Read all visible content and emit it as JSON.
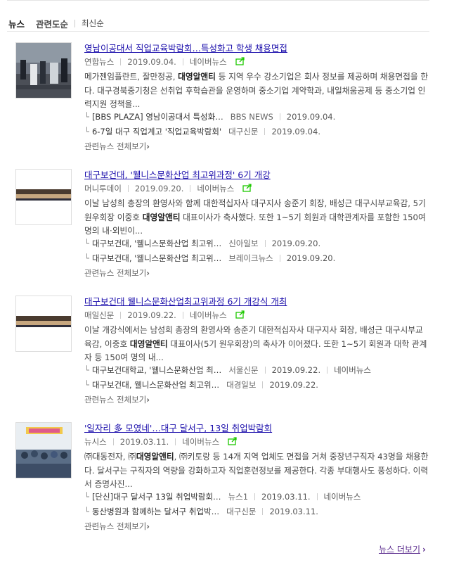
{
  "tabs": [
    {
      "label": "뉴스"
    },
    {
      "label": "관련도순"
    },
    {
      "label": "최신순"
    }
  ],
  "chevron": "›",
  "articles": [
    {
      "title": "영남이공대서 직업교육박람회…특성화고 학생 채용면접",
      "source": "연합뉴스",
      "date": "2019.09.04.",
      "portal": "네이버뉴스",
      "desc_pre": "메가젠임플란트, 잘만정공, ",
      "desc_bold": "대영알앤티",
      "desc_post": " 등 지역 우수 강소기업은 회사 정보를 제공하며 채용면접을 한다. 대구경북중기청은 선취업 후학습관을 운영하며 중소기업 계약학과, 내일채움공제 등 중소기업 인력지원 정책을...",
      "related": [
        {
          "title": "[BBS PLAZA] 영남이공대서 특성화…",
          "source": "BBS NEWS",
          "date": "2019.09.04."
        },
        {
          "title": "6-7일 대구 직업계고 '직업교육박람회'",
          "source": "대구신문",
          "date": "2019.09.04."
        }
      ],
      "more": "관련뉴스 전체보기"
    },
    {
      "title": "대구보건대, '웰니스문화산업 최고위과정' 6기 개강",
      "source": "머니투데이",
      "date": "2019.09.20.",
      "portal": "네이버뉴스",
      "desc_pre": "이날 남성희 총장의 환영사와 함께 대한적십자사 대구지사 송준기 회장, 배성근 대구시부교육감, 5기 원우회장 이중호 ",
      "desc_bold": "대영알앤티",
      "desc_post": " 대표이사가 축사했다. 또한 1~5기 회원과 대학관계자를 포함한 150여 명의 내·외빈이...",
      "related": [
        {
          "title": "대구보건대, '웰니스문화산업 최고위…",
          "source": "신아일보",
          "date": "2019.09.20."
        },
        {
          "title": "대구보건대, '웰니스문화산업 최고위…",
          "source": "브레이크뉴스",
          "date": "2019.09.20."
        }
      ],
      "more": "관련뉴스 전체보기"
    },
    {
      "title": "대구보건대 웰니스문화산업최고위과정 6기 개강식 개최",
      "source": "매일신문",
      "date": "2019.09.22.",
      "portal": "네이버뉴스",
      "desc_pre": "이날 개강식에서는 남성희 총장의 환영사와 송준기 대한적십자사 대구지사 회장, 배성근 대구시부교육감, 이중호 ",
      "desc_bold": "대영알앤티",
      "desc_post": " 대표이사(5기 원우회장)의 축사가 이어졌다. 또한 1~5기 회원과 대학 관계자 등 150여 명의 내...",
      "related": [
        {
          "title": "대구보건대학교, '웰니스문화산업 최…",
          "source": "서울신문",
          "date": "2019.09.22.",
          "portal": "네이버뉴스"
        },
        {
          "title": "대구보건대, 웰니스문화산업 최고위…",
          "source": "대경일보",
          "date": "2019.09.22."
        }
      ],
      "more": "관련뉴스 전체보기"
    },
    {
      "title": "'일자리 多 모였네'…대구 달서구, 13일 취업박람회",
      "source": "뉴시스",
      "date": "2019.03.11.",
      "portal": "네이버뉴스",
      "desc_pre": "㈜대동전자, ㈜",
      "desc_bold": "대영알앤티",
      "desc_post": ", ㈜키토랑 등 14개 지역 업체도 면접을 거쳐 중장년구직자 43명을 채용한다. 달서구는 구직자의 역량을 강화하고자 직업훈련정보를 제공한다. 각종 부대행사도 풍성하다. 이력서 증명사진...",
      "related": [
        {
          "title": "[단신]대구 달서구 13일 취업박람회…",
          "source": "뉴스1",
          "date": "2019.03.11.",
          "portal": "네이버뉴스"
        },
        {
          "title": "동산병원과 함께하는 달서구 취업박…",
          "source": "대구신문",
          "date": "2019.03.11."
        }
      ],
      "more": "관련뉴스 전체보기"
    }
  ],
  "footer": {
    "more_news": "뉴스 더보기"
  },
  "colors": {
    "title_link": "#1a0dab",
    "share_icon": "#1ec800",
    "visited_link": "#5b2d8e"
  }
}
